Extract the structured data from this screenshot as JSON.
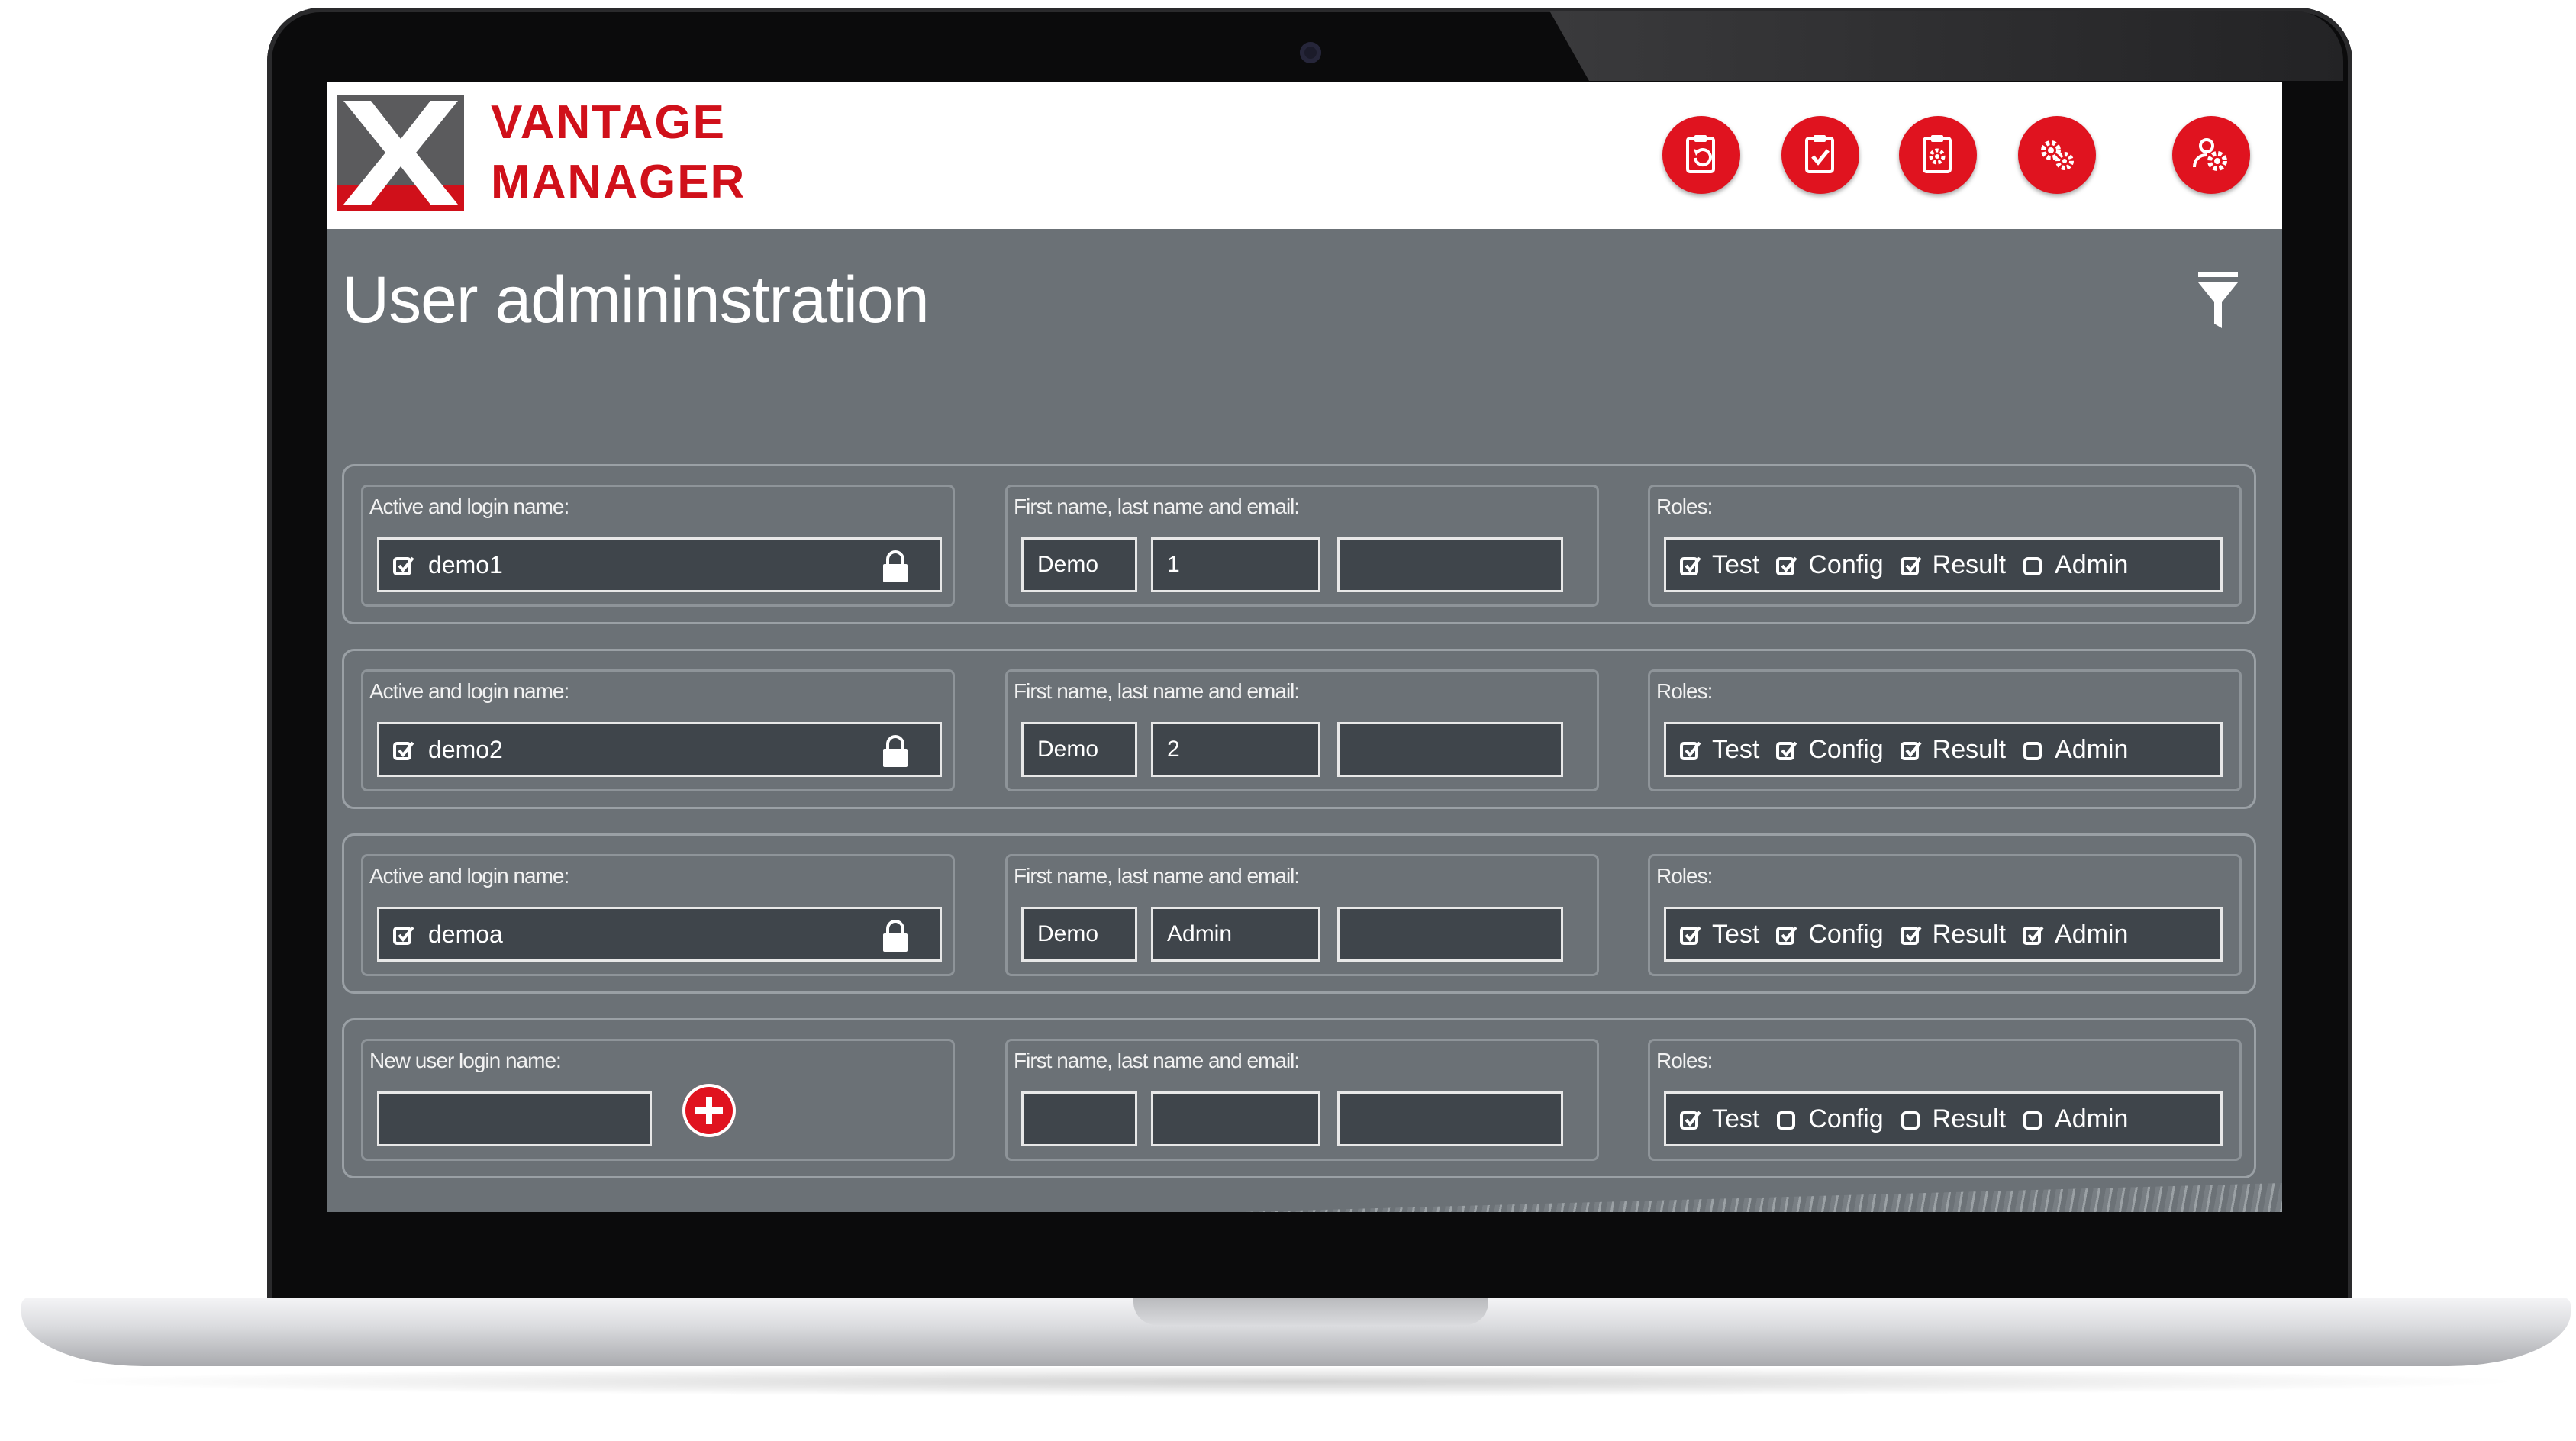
{
  "brand": {
    "line1": "VANTAGE",
    "line2": "MANAGER",
    "accent": "#e0131f"
  },
  "nav": [
    {
      "icon": "clipboard-refresh-icon"
    },
    {
      "icon": "clipboard-check-icon"
    },
    {
      "icon": "clipboard-gear-icon"
    },
    {
      "icon": "gears-icon"
    },
    {
      "icon": "users-gear-icon"
    }
  ],
  "page": {
    "title": "User admininstration",
    "filter_icon": "filter-icon"
  },
  "users": [
    {
      "login_label": "Active and login name:",
      "active": true,
      "login": "demo1",
      "name_label": "First name, last name and email:",
      "first": "Demo",
      "last": "1",
      "email": "",
      "roles_label": "Roles:",
      "roles": [
        {
          "name": "Test",
          "checked": true
        },
        {
          "name": "Config",
          "checked": true
        },
        {
          "name": "Result",
          "checked": true
        },
        {
          "name": "Admin",
          "checked": false
        }
      ]
    },
    {
      "login_label": "Active and login name:",
      "active": true,
      "login": "demo2",
      "name_label": "First name, last name and email:",
      "first": "Demo",
      "last": "2",
      "email": "",
      "roles_label": "Roles:",
      "roles": [
        {
          "name": "Test",
          "checked": true
        },
        {
          "name": "Config",
          "checked": true
        },
        {
          "name": "Result",
          "checked": true
        },
        {
          "name": "Admin",
          "checked": false
        }
      ]
    },
    {
      "login_label": "Active and login name:",
      "active": true,
      "login": "demoa",
      "name_label": "First name, last name and email:",
      "first": "Demo",
      "last": "Admin",
      "email": "",
      "roles_label": "Roles:",
      "roles": [
        {
          "name": "Test",
          "checked": true
        },
        {
          "name": "Config",
          "checked": true
        },
        {
          "name": "Result",
          "checked": true
        },
        {
          "name": "Admin",
          "checked": true
        }
      ]
    }
  ],
  "new_user": {
    "login_label": "New user login name:",
    "login": "",
    "name_label": "First name, last name and email:",
    "first": "",
    "last": "",
    "email": "",
    "roles_label": "Roles:",
    "roles": [
      {
        "name": "Test",
        "checked": true
      },
      {
        "name": "Config",
        "checked": false
      },
      {
        "name": "Result",
        "checked": false
      },
      {
        "name": "Admin",
        "checked": false
      }
    ]
  }
}
